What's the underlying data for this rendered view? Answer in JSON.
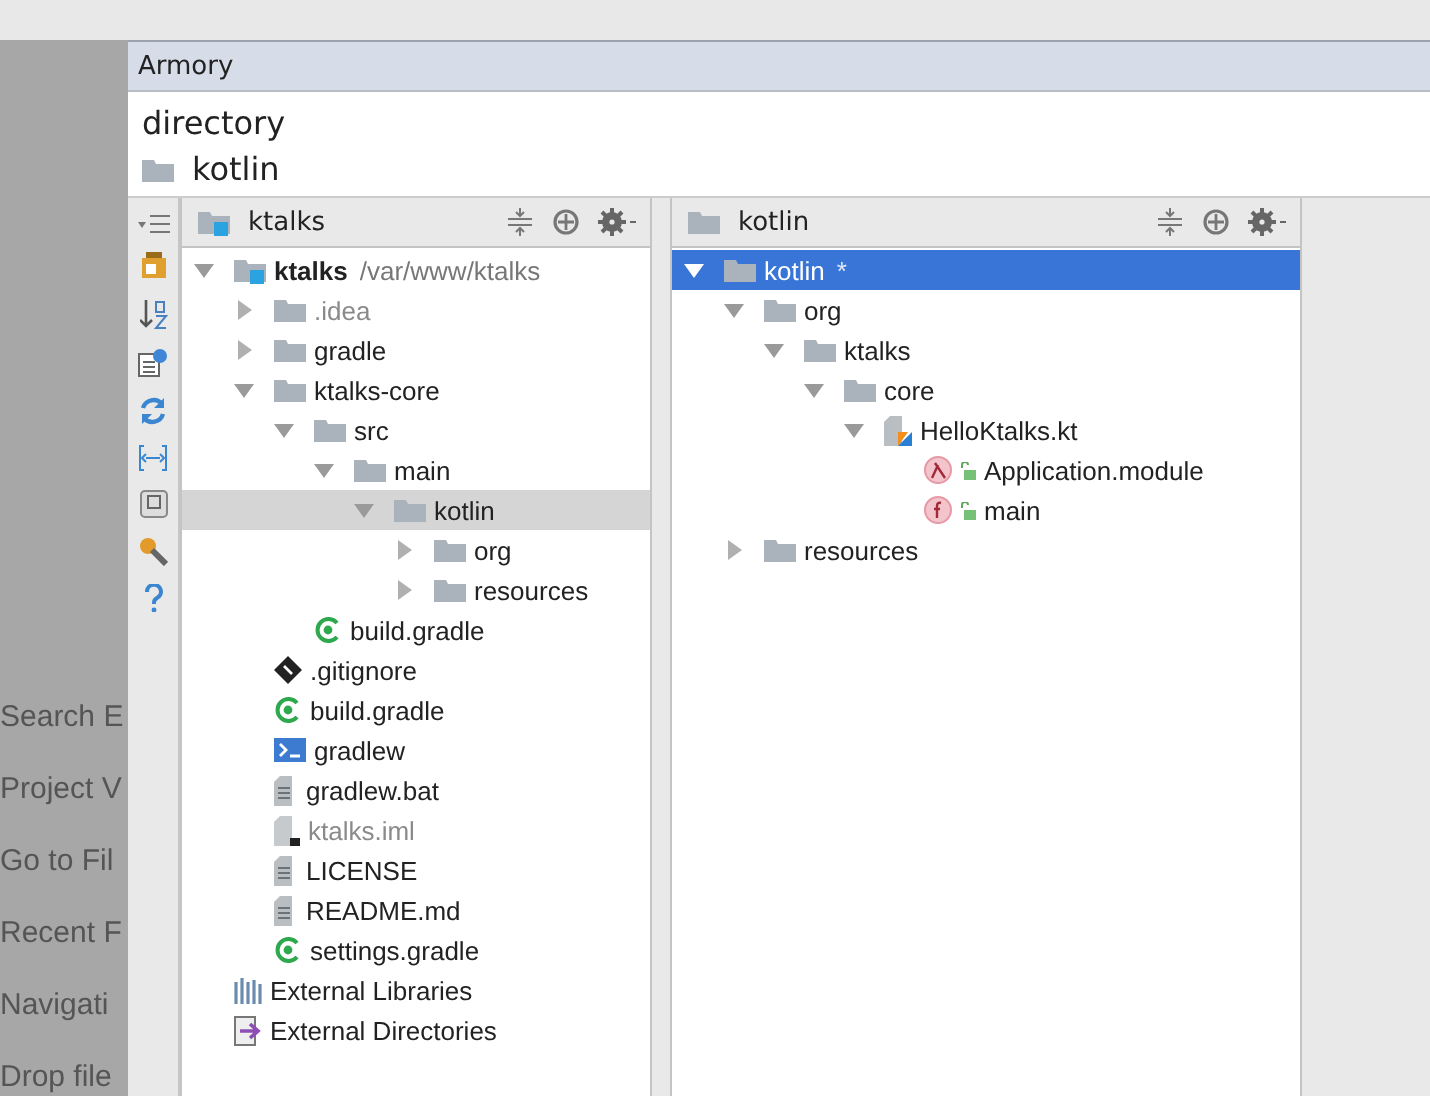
{
  "background_menu": [
    "Search E",
    "Project V",
    "Go to Fil",
    "Recent F",
    "Navigati",
    "Drop file"
  ],
  "window": {
    "title": "Armory"
  },
  "breadcrumb": {
    "heading": "directory",
    "folder": "kotlin"
  },
  "project_panel": {
    "title": "ktalks",
    "tree": [
      {
        "label": "ktalks",
        "location": "/var/www/ktalks",
        "kind": "module",
        "expanded": true,
        "selected": false,
        "dimmed": false,
        "children": [
          {
            "label": ".idea",
            "kind": "folder",
            "expanded": false,
            "selected": false,
            "dimmed": true
          },
          {
            "label": "gradle",
            "kind": "folder",
            "expanded": false,
            "selected": false,
            "dimmed": false
          },
          {
            "label": "ktalks-core",
            "kind": "folder",
            "expanded": true,
            "selected": false,
            "dimmed": false,
            "children": [
              {
                "label": "src",
                "kind": "folder",
                "expanded": true,
                "selected": false,
                "dimmed": false,
                "children": [
                  {
                    "label": "main",
                    "kind": "folder",
                    "expanded": true,
                    "selected": false,
                    "dimmed": false,
                    "children": [
                      {
                        "label": "kotlin",
                        "kind": "folder",
                        "expanded": true,
                        "selected": true,
                        "dimmed": false,
                        "children": [
                          {
                            "label": "org",
                            "kind": "folder",
                            "expanded": false,
                            "selected": false,
                            "dimmed": false
                          },
                          {
                            "label": "resources",
                            "kind": "folder",
                            "expanded": false,
                            "selected": false,
                            "dimmed": false
                          }
                        ]
                      }
                    ]
                  }
                ]
              },
              {
                "label": "build.gradle",
                "kind": "gradle",
                "selected": false,
                "dimmed": false
              }
            ]
          },
          {
            "label": ".gitignore",
            "kind": "git",
            "selected": false,
            "dimmed": false
          },
          {
            "label": "build.gradle",
            "kind": "gradle",
            "selected": false,
            "dimmed": false
          },
          {
            "label": "gradlew",
            "kind": "shell",
            "selected": false,
            "dimmed": false
          },
          {
            "label": "gradlew.bat",
            "kind": "file",
            "selected": false,
            "dimmed": false
          },
          {
            "label": "ktalks.iml",
            "kind": "iml",
            "selected": false,
            "dimmed": true
          },
          {
            "label": "LICENSE",
            "kind": "file",
            "selected": false,
            "dimmed": false
          },
          {
            "label": "README.md",
            "kind": "file",
            "selected": false,
            "dimmed": false
          },
          {
            "label": "settings.gradle",
            "kind": "gradle",
            "selected": false,
            "dimmed": false
          }
        ]
      },
      {
        "label": "External Libraries",
        "kind": "libraries",
        "selected": false,
        "dimmed": false
      },
      {
        "label": "External Directories",
        "kind": "directories",
        "selected": false,
        "dimmed": false
      }
    ]
  },
  "structure_panel": {
    "title": "kotlin",
    "tree": [
      {
        "label": "kotlin",
        "location": "*",
        "kind": "folder",
        "expanded": true,
        "selected": true,
        "dimmed": false,
        "children": [
          {
            "label": "org",
            "kind": "folder",
            "expanded": true,
            "selected": false,
            "dimmed": false,
            "children": [
              {
                "label": "ktalks",
                "kind": "folder",
                "expanded": true,
                "selected": false,
                "dimmed": false,
                "children": [
                  {
                    "label": "core",
                    "kind": "folder",
                    "expanded": true,
                    "selected": false,
                    "dimmed": false,
                    "children": [
                      {
                        "label": "HelloKtalks.kt",
                        "kind": "kotlin-file",
                        "expanded": true,
                        "selected": false,
                        "dimmed": false,
                        "children": [
                          {
                            "label": "Application.module",
                            "kind": "lambda",
                            "selected": false,
                            "dimmed": false
                          },
                          {
                            "label": "main",
                            "kind": "function",
                            "selected": false,
                            "dimmed": false
                          }
                        ]
                      }
                    ]
                  }
                ]
              }
            ]
          },
          {
            "label": "resources",
            "kind": "folder",
            "expanded": false,
            "selected": false,
            "dimmed": false
          }
        ]
      }
    ]
  }
}
